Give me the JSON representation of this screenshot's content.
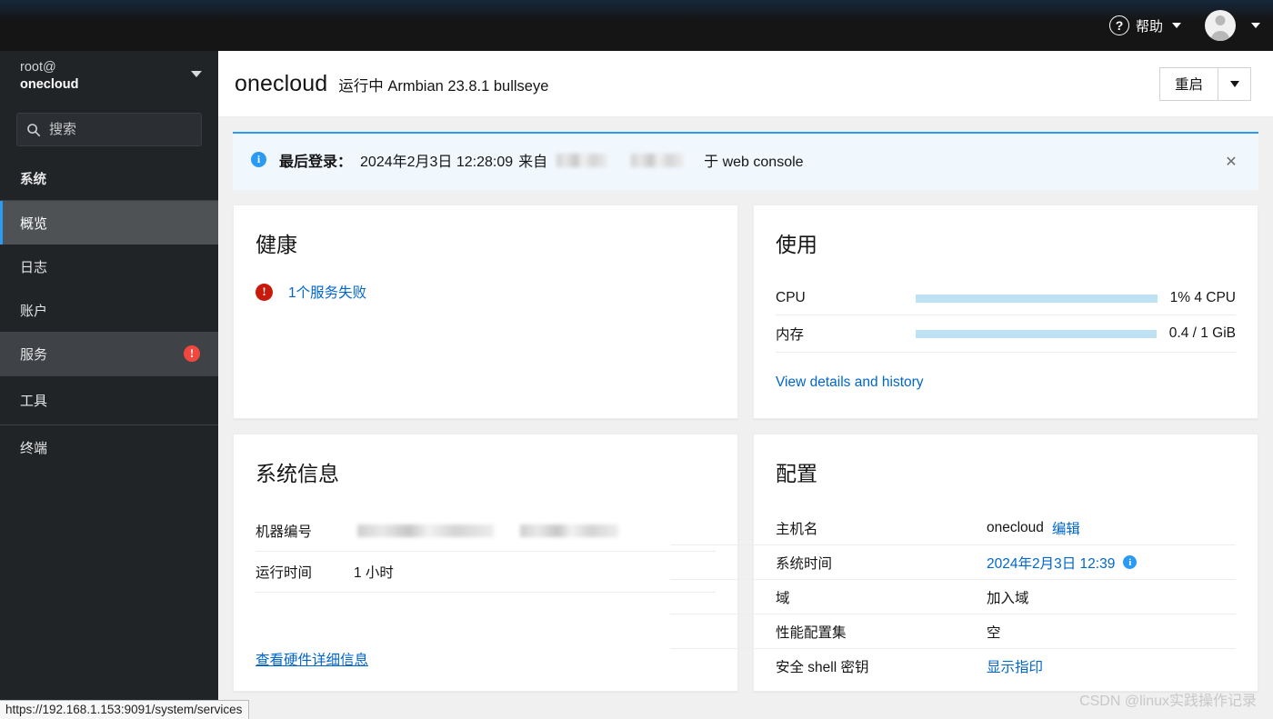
{
  "masthead": {
    "help_label": "帮助",
    "help_icon": "question-circle-icon",
    "user_icon": "avatar-icon"
  },
  "sidebar": {
    "host_user": "root@",
    "host_name": "onecloud",
    "search_placeholder": "搜索",
    "search_value": "",
    "group_label": "系统",
    "items": [
      {
        "label": "概览",
        "state": "active",
        "badge": ""
      },
      {
        "label": "日志",
        "state": "normal",
        "badge": ""
      },
      {
        "label": "账户",
        "state": "normal",
        "badge": ""
      },
      {
        "label": "服务",
        "state": "highlight",
        "badge": "!"
      }
    ],
    "tools_label": "工具",
    "terminal_label": "终端"
  },
  "page_header": {
    "hostname": "onecloud",
    "state_text": "运行中 Armbian 23.8.1 bullseye",
    "restart_label": "重启"
  },
  "alert": {
    "icon": "info-circle-icon",
    "label": "最后登录：",
    "datetime": "2024年2月3日 12:28:09",
    "from_word": "来自",
    "redacted_host_1": "",
    "redacted_host_2": "",
    "at_word": "于 web console",
    "close_label": "✕"
  },
  "health": {
    "title": "健康",
    "status_icon": "error-circle-icon",
    "failed_services": "1个服务失败"
  },
  "usage": {
    "title": "使用",
    "rows": [
      {
        "label": "CPU",
        "value": "1% 4 CPU",
        "percent": 2
      },
      {
        "label": "内存",
        "value": "0.4 / 1 GiB",
        "percent": 40
      }
    ],
    "details_link": "View details and history"
  },
  "system_info": {
    "title": "系统信息",
    "rows": [
      {
        "key": "机器编号",
        "value": "",
        "redacted": true
      },
      {
        "key": "运行时间",
        "value": "1 小时",
        "redacted": false
      }
    ],
    "hardware_link": "查看硬件详细信息"
  },
  "configuration": {
    "title": "配置",
    "rows": [
      {
        "key": "主机名",
        "value": "onecloud",
        "link": "编辑",
        "badge": ""
      },
      {
        "key": "系统时间",
        "value": "",
        "link": "2024年2月3日 12:39",
        "badge": "i"
      },
      {
        "key": "域",
        "value": "",
        "link": "加入域",
        "badge": ""
      },
      {
        "key": "性能配置集",
        "value": "空",
        "link": "",
        "badge": ""
      },
      {
        "key": "安全 shell 密钥",
        "value": "",
        "link": "显示指印",
        "badge": ""
      }
    ]
  },
  "statusbar": {
    "url": "https://192.168.1.153:9091/system/services"
  },
  "watermark": {
    "text": "CSDN @linux实践操作记录"
  },
  "colors": {
    "accent_blue": "#06c",
    "link_blue": "#2b9af3",
    "danger_red": "#c9190b",
    "badge_red": "#f0483e",
    "sidebar_bg": "#212427",
    "masthead_bg": "#151515",
    "content_bg": "#f0f0f0"
  }
}
